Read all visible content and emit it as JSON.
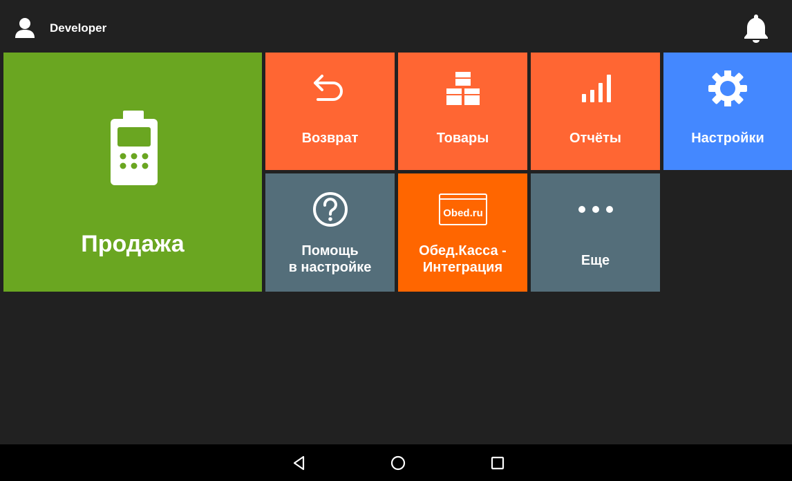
{
  "header": {
    "username": "Developer",
    "user_icon": "user-icon",
    "notification_icon": "bell-icon"
  },
  "tiles": [
    {
      "id": "sale",
      "label": "Продажа",
      "icon": "payment-terminal-icon",
      "color": "#6aa621"
    },
    {
      "id": "return",
      "label": "Возврат",
      "icon": "return-arrow-icon",
      "color": "#ff6633"
    },
    {
      "id": "goods",
      "label": "Товары",
      "icon": "boxes-icon",
      "color": "#ff6633"
    },
    {
      "id": "reports",
      "label": "Отчёты",
      "icon": "bar-chart-icon",
      "color": "#ff6633"
    },
    {
      "id": "settings",
      "label": "Настройки",
      "icon": "gear-icon",
      "color": "#4488ff"
    },
    {
      "id": "help",
      "label_line1": "Помощь",
      "label_line2": "в настройке",
      "icon": "help-circle-icon",
      "color": "#546e7a"
    },
    {
      "id": "obed",
      "label_line1": "Обед.Касса -",
      "label_line2": "Интеграция",
      "icon": "obed-logo-icon",
      "logo_text": "Obed.ru",
      "color": "#ff6600"
    },
    {
      "id": "more",
      "label": "Еще",
      "icon": "more-dots-icon",
      "color": "#546e7a"
    }
  ],
  "navbar": {
    "back_icon": "back-triangle-icon",
    "home_icon": "home-circle-icon",
    "recent_icon": "recent-square-icon"
  }
}
